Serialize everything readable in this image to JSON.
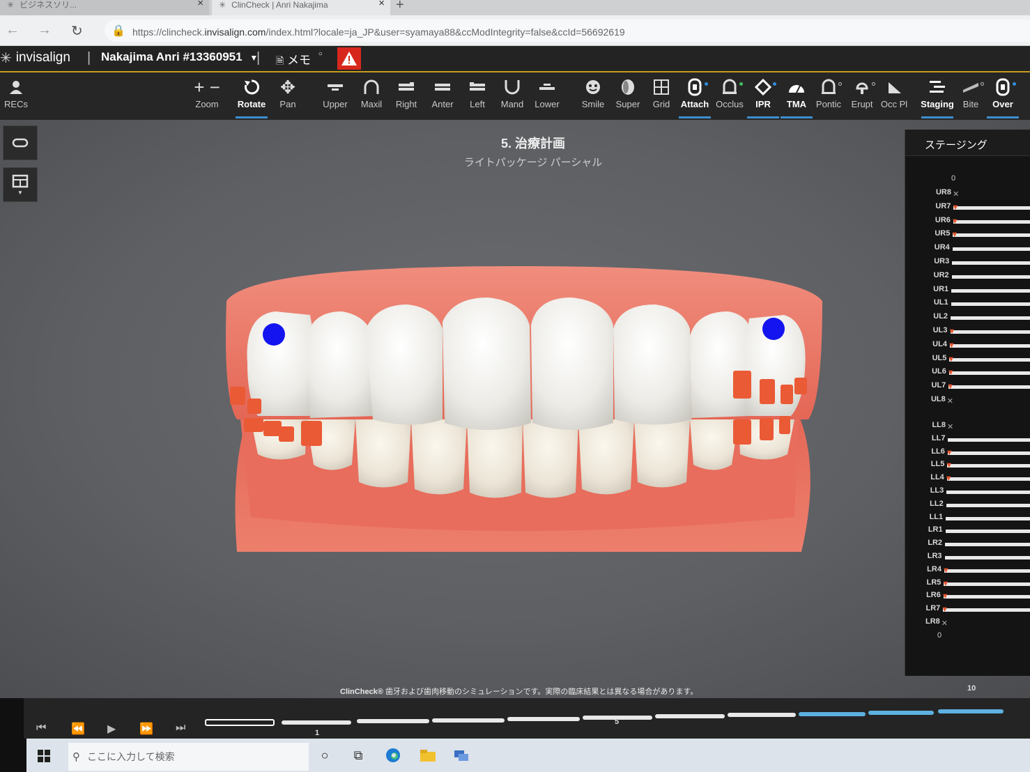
{
  "browser": {
    "tab1_title": "ビジネスソリ...",
    "tab2_title": "ClinCheck | Anri Nakajima",
    "url_prefix": "https://clincheck.",
    "url_domain": "invisalign.com",
    "url_rest": "/index.html?locale=ja_JP&user=syamaya88&ccModIntegrity=false&ccId=56692619"
  },
  "header": {
    "logo": "invisalign",
    "patient": "Nakajima Anri #13360951",
    "memo_label": "メモ"
  },
  "toolbar": [
    {
      "id": "recs",
      "label": "RECs",
      "icon": "person-icon"
    },
    {
      "id": "zoom",
      "label": "Zoom",
      "icon": "zoom-icon"
    },
    {
      "id": "rotate",
      "label": "Rotate",
      "icon": "rotate-icon",
      "active": true
    },
    {
      "id": "pan",
      "label": "Pan",
      "icon": "pan-icon"
    },
    {
      "id": "upper",
      "label": "Upper",
      "icon": "upper-icon"
    },
    {
      "id": "maxil",
      "label": "Maxil",
      "icon": "maxil-icon"
    },
    {
      "id": "right",
      "label": "Right",
      "icon": "right-icon"
    },
    {
      "id": "anter",
      "label": "Anter",
      "icon": "anter-icon"
    },
    {
      "id": "left",
      "label": "Left",
      "icon": "left-icon"
    },
    {
      "id": "mand",
      "label": "Mand",
      "icon": "mand-icon"
    },
    {
      "id": "lower",
      "label": "Lower",
      "icon": "lower-icon"
    },
    {
      "id": "smile",
      "label": "Smile",
      "icon": "smile-icon"
    },
    {
      "id": "super",
      "label": "Super",
      "icon": "super-icon"
    },
    {
      "id": "grid",
      "label": "Grid",
      "icon": "grid-icon"
    },
    {
      "id": "attach",
      "label": "Attach",
      "icon": "attach-icon",
      "active": true
    },
    {
      "id": "occlus",
      "label": "Occlus",
      "icon": "occlus-icon"
    },
    {
      "id": "ipr",
      "label": "IPR",
      "icon": "ipr-icon",
      "active": true
    },
    {
      "id": "tma",
      "label": "TMA",
      "icon": "tma-icon",
      "active": true
    },
    {
      "id": "pontic",
      "label": "Pontic",
      "icon": "pontic-icon"
    },
    {
      "id": "erupt",
      "label": "Erupt",
      "icon": "erupt-icon"
    },
    {
      "id": "occpl",
      "label": "Occ Pl",
      "icon": "occpl-icon"
    },
    {
      "id": "staging",
      "label": "Staging",
      "icon": "staging-icon",
      "active": true
    },
    {
      "id": "bite",
      "label": "Bite",
      "icon": "bite-icon"
    },
    {
      "id": "over",
      "label": "Over",
      "icon": "over-icon",
      "active": true
    }
  ],
  "viewport": {
    "title": "5. 治療計画",
    "subtitle": "ライトパッケージ パーシャル",
    "disclaimer_brand": "ClinCheck®",
    "disclaimer_text": " 歯牙および歯肉移動のシミュレーションです。実際の臨床結果とは異なる場合があります。"
  },
  "staging": {
    "title": "ステージング",
    "top_zero": "0",
    "bottom_zero": "0",
    "upper": [
      {
        "tooth": "UR8",
        "mark": "x"
      },
      {
        "tooth": "UR7",
        "mark": "tri"
      },
      {
        "tooth": "UR6",
        "mark": "tri"
      },
      {
        "tooth": "UR5",
        "mark": "tri"
      },
      {
        "tooth": "UR4",
        "mark": ""
      },
      {
        "tooth": "UR3",
        "mark": ""
      },
      {
        "tooth": "UR2",
        "mark": ""
      },
      {
        "tooth": "UR1",
        "mark": ""
      },
      {
        "tooth": "UL1",
        "mark": ""
      },
      {
        "tooth": "UL2",
        "mark": ""
      },
      {
        "tooth": "UL3",
        "mark": "tri"
      },
      {
        "tooth": "UL4",
        "mark": "tri"
      },
      {
        "tooth": "UL5",
        "mark": "tri"
      },
      {
        "tooth": "UL6",
        "mark": "tri"
      },
      {
        "tooth": "UL7",
        "mark": "tri"
      },
      {
        "tooth": "UL8",
        "mark": "x"
      }
    ],
    "lower": [
      {
        "tooth": "LL8",
        "mark": "x"
      },
      {
        "tooth": "LL7",
        "mark": ""
      },
      {
        "tooth": "LL6",
        "mark": "tri"
      },
      {
        "tooth": "LL5",
        "mark": "tri"
      },
      {
        "tooth": "LL4",
        "mark": "tri"
      },
      {
        "tooth": "LL3",
        "mark": ""
      },
      {
        "tooth": "LL2",
        "mark": ""
      },
      {
        "tooth": "LL1",
        "mark": ""
      },
      {
        "tooth": "LR1",
        "mark": ""
      },
      {
        "tooth": "LR2",
        "mark": ""
      },
      {
        "tooth": "LR3",
        "mark": ""
      },
      {
        "tooth": "LR4",
        "mark": "tri"
      },
      {
        "tooth": "LR5",
        "mark": "tri"
      },
      {
        "tooth": "LR6",
        "mark": "tri"
      },
      {
        "tooth": "LR7",
        "mark": "tri"
      },
      {
        "tooth": "LR8",
        "mark": "x"
      }
    ]
  },
  "timeline": {
    "stage_labels": [
      "1",
      "5",
      "10"
    ],
    "current_stage": 0
  },
  "taskbar": {
    "search_placeholder": "ここに入力して検索"
  },
  "colors": {
    "accent_blue": "#3c8fd0",
    "warning_red": "#d7271d",
    "attachment_orange": "#e8552d",
    "gum_pink": "#e9705f",
    "marker_blue": "#1414f0"
  }
}
